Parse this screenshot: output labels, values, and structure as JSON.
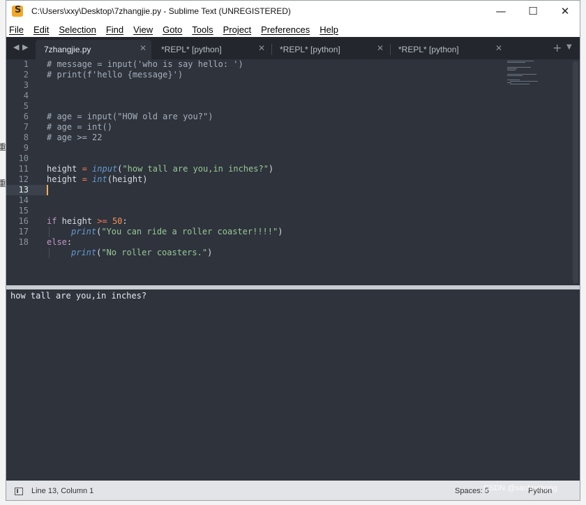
{
  "window": {
    "title": "C:\\Users\\xxy\\Desktop\\7zhangjie.py - Sublime Text (UNREGISTERED)",
    "controls": {
      "minimize": "—",
      "maximize": "☐",
      "close": "✕"
    }
  },
  "menu": [
    "File",
    "Edit",
    "Selection",
    "Find",
    "View",
    "Goto",
    "Tools",
    "Project",
    "Preferences",
    "Help"
  ],
  "tabs": {
    "nav_left": "◀",
    "nav_right": "▶",
    "items": [
      {
        "label": "7zhangjie.py",
        "close": "✕"
      },
      {
        "label": "*REPL* [python]",
        "close": "✕"
      },
      {
        "label": "*REPL* [python]",
        "close": "✕"
      },
      {
        "label": "*REPL* [python]",
        "close": "✕"
      }
    ],
    "add": "+",
    "menu": "▼"
  },
  "editor": {
    "line_numbers": [
      "1",
      "2",
      "3",
      "4",
      "5",
      "6",
      "7",
      "8",
      "9",
      "10",
      "11",
      "12",
      "13",
      "14",
      "15",
      "16",
      "17",
      "18"
    ],
    "current_line": 13,
    "lines": {
      "l1": "# message = input('who is say hello: ')",
      "l2": "# print(f'hello {message}')",
      "l6": "# age = input(\"HOW old are you?\")",
      "l7": "# age = int()",
      "l8": "# age >= 22",
      "l11": {
        "var": "height",
        "op": " = ",
        "fn": "input",
        "open": "(",
        "str": "\"how tall are you,in inches?\"",
        "close": ")"
      },
      "l12": {
        "var": "height",
        "op": " = ",
        "fn": "int",
        "rest": "(height)"
      },
      "l15": {
        "kw": "if",
        "var": " height ",
        "op": ">=",
        "sp": " ",
        "num": "50",
        "colon": ":"
      },
      "l16": {
        "fn": "print",
        "open": "(",
        "str": "\"You can ride a roller coaster!!!!\"",
        "close": ")"
      },
      "l17": {
        "kw": "else",
        "colon": ":"
      },
      "l18": {
        "fn": "print",
        "open": "(",
        "str": "\"No roller coasters.\"",
        "close": ")"
      }
    }
  },
  "output": {
    "text": "how tall are you,in inches?"
  },
  "status": {
    "position": "Line 13, Column 1",
    "spaces": "Spaces: 5",
    "syntax": "Python",
    "watermark": "CSDN @sanhuohong"
  },
  "colors": {
    "editor_bg": "#2e333c",
    "tabbar_bg": "#23262c",
    "caret": "#f9ae58",
    "string": "#99c794",
    "function": "#6699cc",
    "operator": "#f97b58",
    "number": "#f99157"
  }
}
